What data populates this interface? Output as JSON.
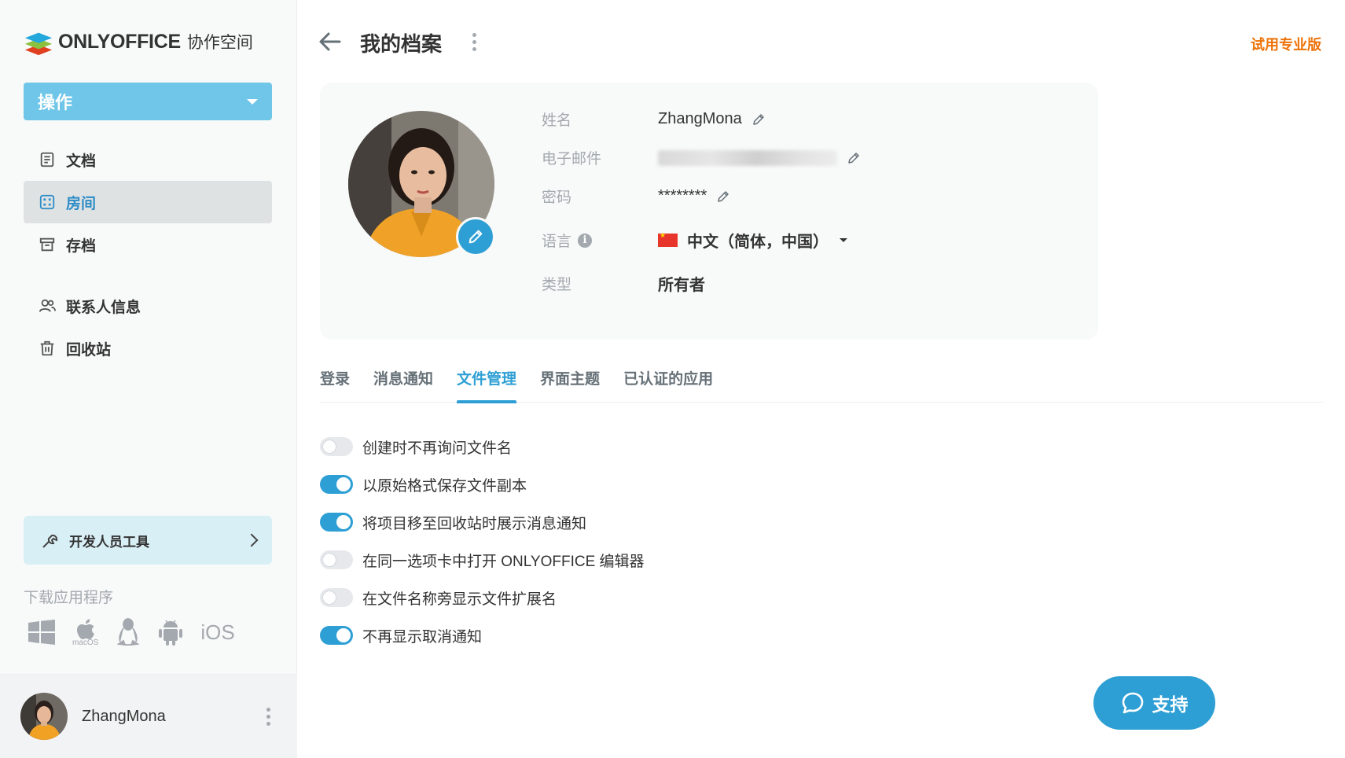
{
  "app": {
    "logo_text": "ONLYOFFICE",
    "logo_sub": "协作空间"
  },
  "sidebar": {
    "actions_label": "操作",
    "items": [
      {
        "label": "文档",
        "icon": "document-icon"
      },
      {
        "label": "房间",
        "icon": "rooms-icon",
        "active": true
      },
      {
        "label": "存档",
        "icon": "archive-icon"
      },
      {
        "label": "联系人信息",
        "icon": "contacts-icon"
      },
      {
        "label": "回收站",
        "icon": "trash-icon"
      }
    ],
    "dev_tools_label": "开发人员工具",
    "download_label": "下载应用程序",
    "apps": [
      "windows-icon",
      "macos-icon",
      "linux-icon",
      "android-icon",
      "ios-icon"
    ],
    "macos_label": "macOS",
    "ios_label": "iOS",
    "user_name": "ZhangMona"
  },
  "header": {
    "title": "我的档案",
    "trial_link": "试用专业版"
  },
  "profile": {
    "fields": {
      "name_label": "姓名",
      "name_value": "ZhangMona",
      "email_label": "电子邮件",
      "password_label": "密码",
      "password_value": "********",
      "language_label": "语言",
      "language_value": "中文（简体，中国）",
      "type_label": "类型",
      "type_value": "所有者"
    }
  },
  "tabs": [
    {
      "label": "登录",
      "active": false
    },
    {
      "label": "消息通知",
      "active": false
    },
    {
      "label": "文件管理",
      "active": true
    },
    {
      "label": "界面主题",
      "active": false
    },
    {
      "label": "已认证的应用",
      "active": false
    }
  ],
  "toggles": [
    {
      "label": "创建时不再询问文件名",
      "on": false
    },
    {
      "label": "以原始格式保存文件副本",
      "on": true
    },
    {
      "label": "将项目移至回收站时展示消息通知",
      "on": true
    },
    {
      "label": "在同一选项卡中打开 ONLYOFFICE 编辑器",
      "on": false
    },
    {
      "label": "在文件名称旁显示文件扩展名",
      "on": false
    },
    {
      "label": "不再显示取消通知",
      "on": true
    }
  ],
  "support": {
    "label": "支持"
  },
  "colors": {
    "accent": "#2e9fd4",
    "actions_button": "#6fc6e8",
    "trial": "#ed7309",
    "active_nav_bg": "#dfe2e3"
  }
}
